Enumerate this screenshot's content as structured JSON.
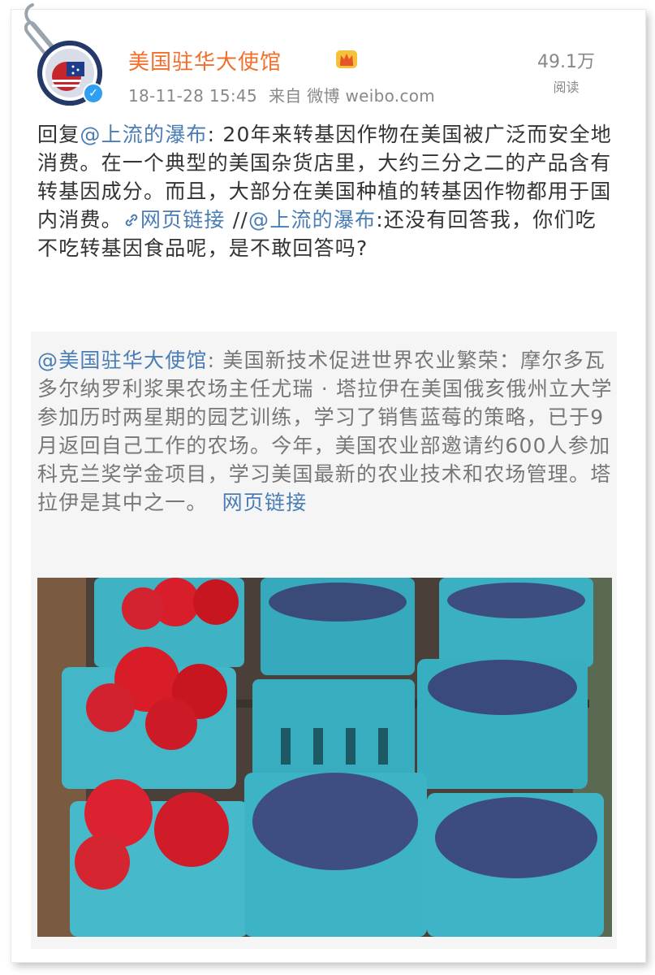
{
  "header": {
    "account_name": "美国驻华大使馆",
    "timestamp": "18-11-28 15:45",
    "source": "来自 微博 weibo.com",
    "read_count": "49.1万",
    "read_label": "阅读"
  },
  "post": {
    "reply_prefix": "回复",
    "mention_1": "@上流的瀑布",
    "body_1": ": 20年来转基因作物在美国被广泛而安全地消费。在一个典型的美国杂货店里，大约三分之二的产品含有转基因成分。而且，大部分在美国种植的转基因作物都用于国内消费。",
    "web_link_1": "网页链接",
    "separator": " //",
    "mention_2": "@上流的瀑布",
    "body_2": ":还没有回答我，你们吃不吃转基因食品呢，是不敢回答吗?"
  },
  "repost": {
    "mention": "@美国驻华大使馆",
    "body": ": 美国新技术促进世界农业繁荣：摩尔多瓦多尔纳罗利浆果农场主任尤瑞 · 塔拉伊在美国俄亥俄州立大学参加历时两星期的园艺训练，学习了销售蓝莓的策略，已于9月返回自己工作的农场。今年，美国农业部邀请约600人参加科克兰奖学金项目，学习美国最新的农业技术和农场管理。塔拉伊是其中之一。",
    "web_link": "网页链接"
  },
  "icons": {
    "verified": "verified-badge-icon",
    "vip": "crown-icon",
    "link": "link-icon",
    "paperclip": "paperclip-icon"
  },
  "colors": {
    "name": "#f46e2a",
    "link": "#4a7db5",
    "body": "#333333",
    "repost_text": "#777777",
    "repost_bg": "#f5f5f5"
  }
}
